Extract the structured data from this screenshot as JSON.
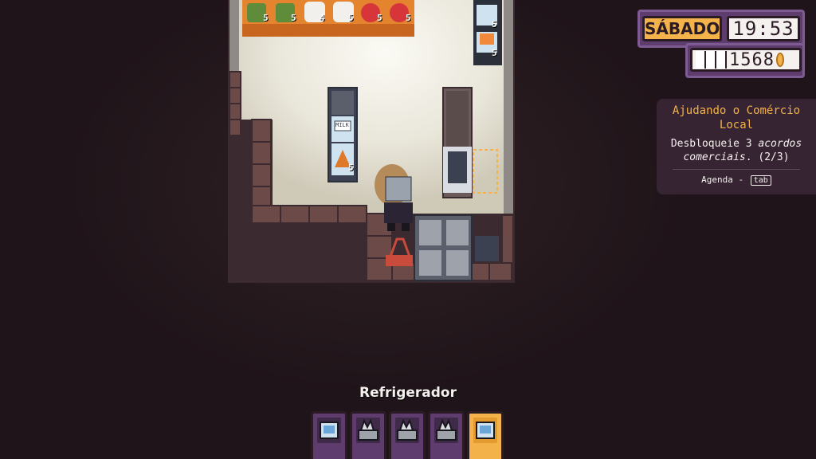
{
  "hud": {
    "day": "SÁBADO",
    "time": "19:53",
    "money": "1568"
  },
  "quest": {
    "title": "Ajudando o Comércio Local",
    "desc_prefix": "Desbloqueie 3 ",
    "desc_emph": "acordos comerciais",
    "desc_suffix": ". (2/3)",
    "agenda_label": "Agenda -",
    "agenda_key": "tab"
  },
  "shelf": {
    "counts": [
      "5",
      "5",
      "4",
      "5",
      "5",
      "5"
    ],
    "items": [
      "pickle-jar",
      "pickle-jar",
      "toilet-paper",
      "toilet-paper",
      "tomato",
      "tomato"
    ]
  },
  "right_rack": {
    "counts": [
      "5",
      "5"
    ]
  },
  "fridge_rack": {
    "count": "5",
    "label": "MILK"
  },
  "selected_item": "Refrigerador",
  "hotbar": {
    "slots": [
      "refrigerator-icon",
      "checkout-icon",
      "checkout-icon",
      "checkout-icon",
      "refrigerator-icon"
    ],
    "selected_index": 4
  },
  "colors": {
    "background": "#1f1419",
    "hud_panel": "#5e3d6e",
    "accent": "#f3b24a",
    "floor": "#ece9e0"
  }
}
